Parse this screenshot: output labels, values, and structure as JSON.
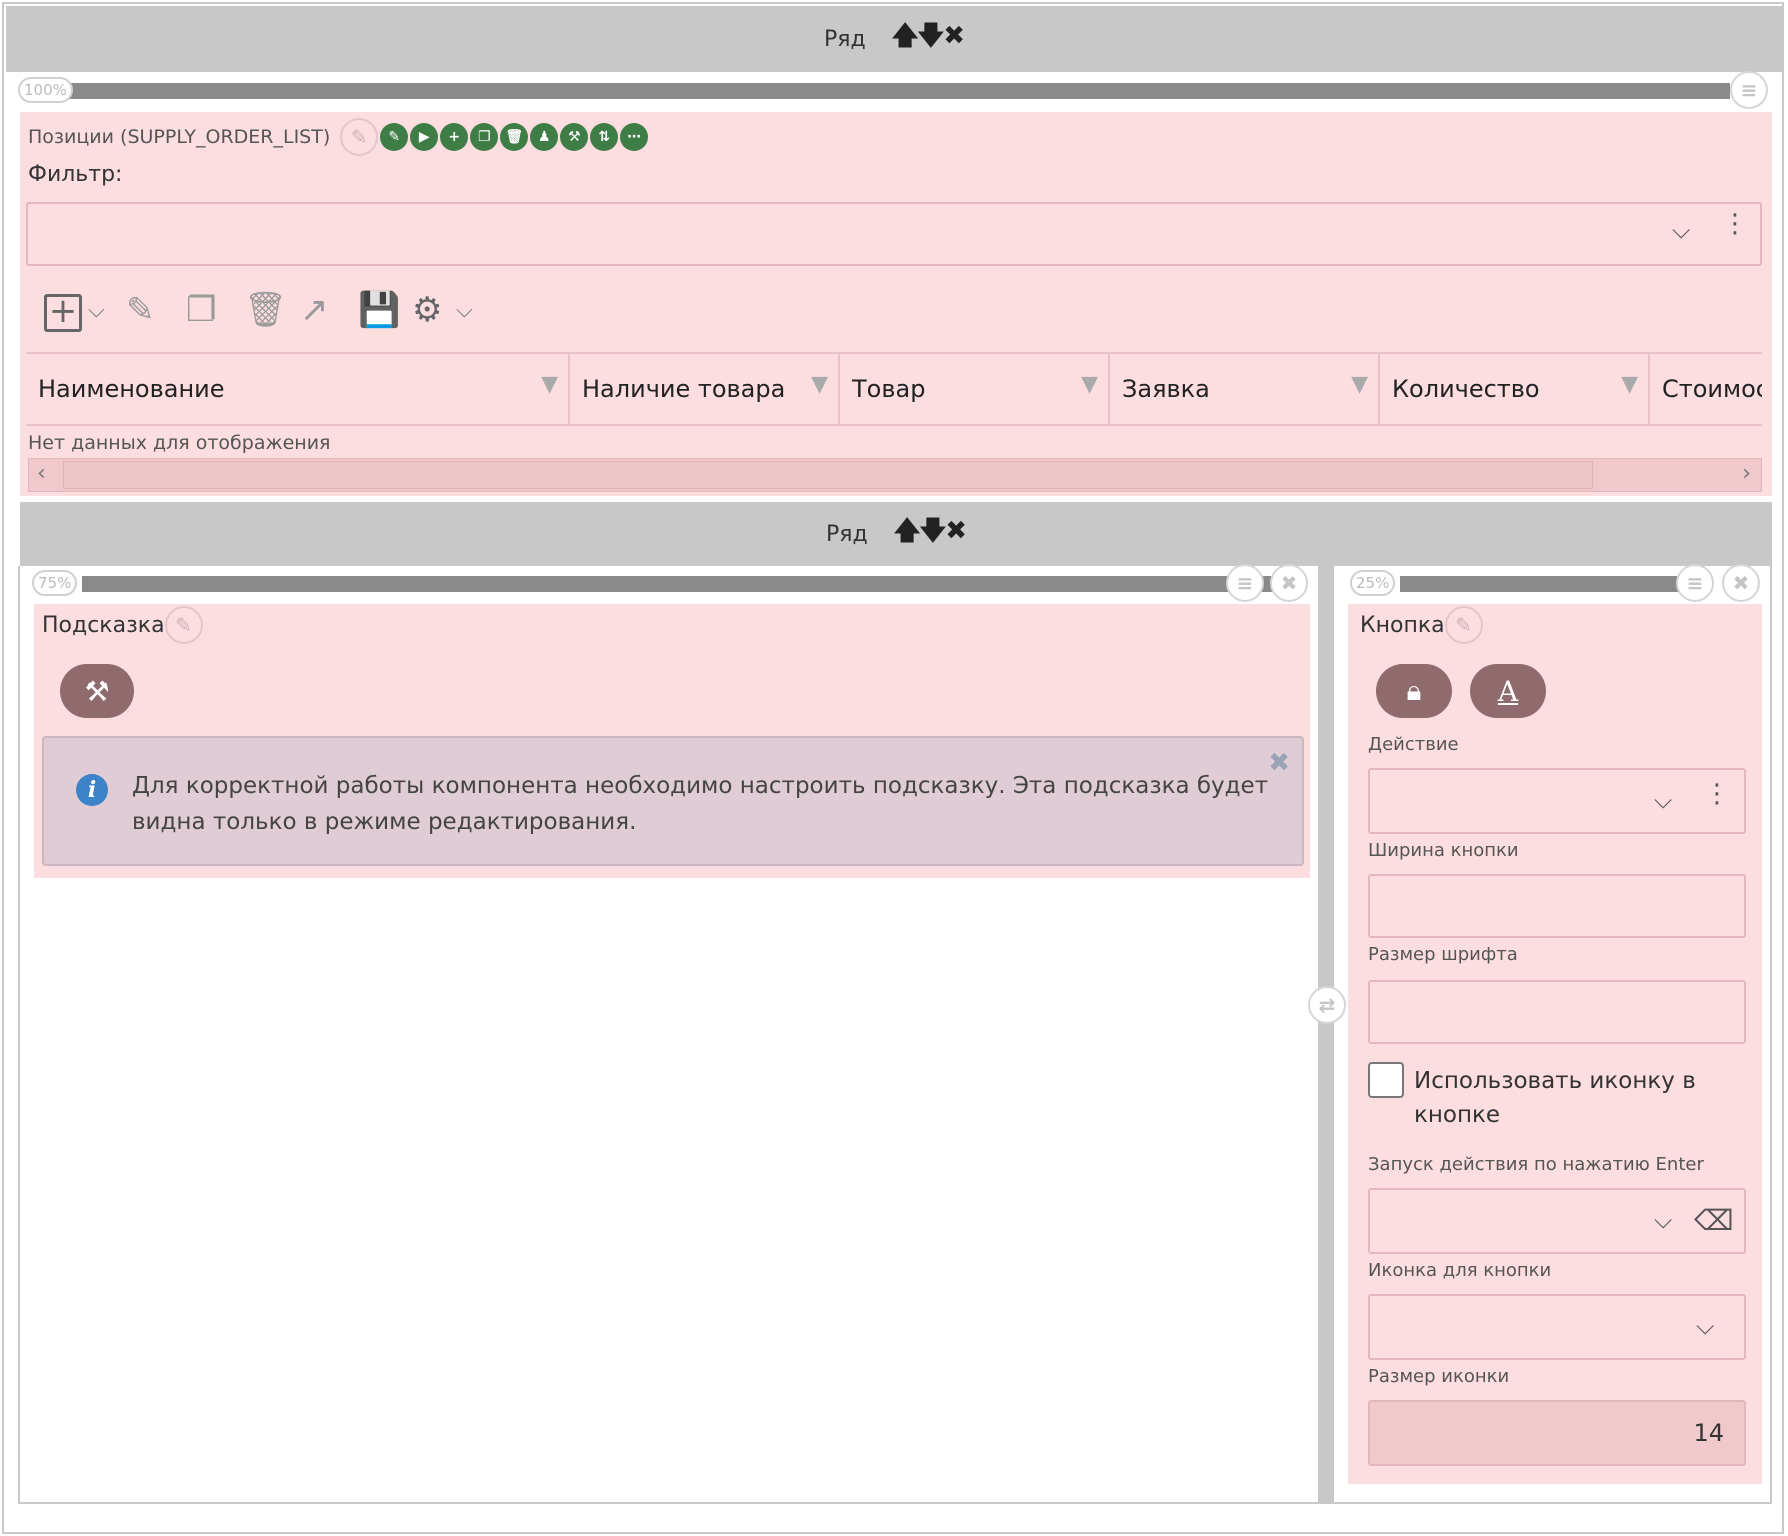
{
  "top_row": {
    "label": "Ряд",
    "controls": "🡅🡇✖"
  },
  "top_column": {
    "percent": "100%",
    "menu_icon": "list-icon"
  },
  "table_panel": {
    "title": "Позиции (SUPPLY_ORDER_LIST)",
    "action_icons": [
      "pencil-icon",
      "play-icon",
      "plus-icon",
      "copy-icon",
      "trash-icon",
      "user-icon",
      "wrench-icon",
      "sort-icon",
      "more-icon"
    ],
    "filter_label": "Фильтр:",
    "filter_value": "",
    "toolbar": [
      "add-icon",
      "edit-icon",
      "copy-icon",
      "delete-icon",
      "export-icon",
      "save-icon",
      "settings-icon"
    ],
    "columns": [
      {
        "label": "Наименование"
      },
      {
        "label": "Наличие товара"
      },
      {
        "label": "Товар"
      },
      {
        "label": "Заявка"
      },
      {
        "label": "Количество"
      },
      {
        "label": "Стоимос"
      }
    ],
    "no_data": "Нет данных для отображения"
  },
  "second_row": {
    "label": "Ряд",
    "controls": "🡅🡇✖"
  },
  "left_column": {
    "percent": "75%"
  },
  "right_column": {
    "percent": "25%"
  },
  "hint_panel": {
    "title": "Подсказка",
    "message": "Для корректной работы компонента необходимо настроить подсказку. Эта подсказка будет видна только в режиме редактирования."
  },
  "button_panel": {
    "title": "Кнопка",
    "action_label": "Действие",
    "action_value": "",
    "width_label": "Ширина кнопки",
    "width_value": "",
    "font_size_label": "Размер шрифта",
    "font_size_value": "",
    "use_icon_label": "Использовать иконку в кнопке",
    "use_icon_checked": false,
    "enter_label": "Запуск действия по нажатию Enter",
    "enter_value": "",
    "icon_label": "Иконка для кнопки",
    "icon_value": "",
    "icon_size_label": "Размер иконки",
    "icon_size_value": "14"
  },
  "colors": {
    "panel_bg": "#fcdde0",
    "row_header_bg": "#c8c8c8",
    "green_btn": "#3f7d46",
    "pill_btn": "#8f6b6e",
    "info_blue": "#3d83c7"
  }
}
